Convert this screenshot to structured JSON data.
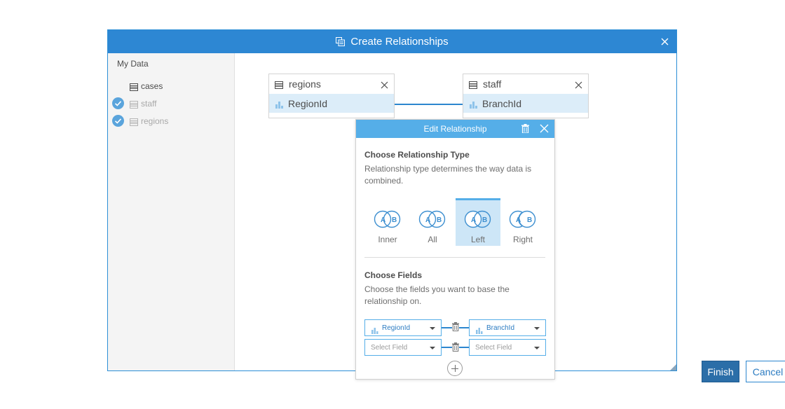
{
  "dialog": {
    "title": "Create Relationships",
    "title_icon": "relationship-icon",
    "close_icon": "close-icon"
  },
  "sidebar": {
    "heading": "My Data",
    "datasets": [
      {
        "label": "cases",
        "icon": "table-icon",
        "checked": false
      },
      {
        "label": "staff",
        "icon": "table-icon",
        "checked": true
      },
      {
        "label": "regions",
        "icon": "table-icon",
        "checked": true
      }
    ]
  },
  "canvas": {
    "left_card": {
      "title": "regions",
      "field": "RegionId",
      "icon": "table-icon",
      "field_icon": "field-icon"
    },
    "right_card": {
      "title": "staff",
      "field": "BranchId",
      "icon": "table-icon",
      "field_icon": "field-icon"
    },
    "link_icon": "pencil-icon",
    "finish_label": "Finish",
    "cancel_label": "Cancel"
  },
  "edit_panel": {
    "title": "Edit Relationship",
    "delete_icon": "trash-icon",
    "close_icon": "close-icon",
    "type_heading": "Choose Relationship Type",
    "type_desc": "Relationship type determines the way data is combined.",
    "join_types": [
      {
        "label": "Inner",
        "selected": false
      },
      {
        "label": "All",
        "selected": false
      },
      {
        "label": "Left",
        "selected": true
      },
      {
        "label": "Right",
        "selected": false
      }
    ],
    "venn_labels": {
      "a": "A",
      "b": "B"
    },
    "fields_heading": "Choose Fields",
    "fields_desc": "Choose the fields you want to base the relationship on.",
    "field_rows": [
      {
        "left": "RegionId",
        "right": "BranchId",
        "filled": true
      },
      {
        "left": "Select Field",
        "right": "Select Field",
        "filled": false
      }
    ],
    "add_icon": "plus-icon",
    "accent": "#55aee8",
    "primary": "#2d87d3"
  }
}
